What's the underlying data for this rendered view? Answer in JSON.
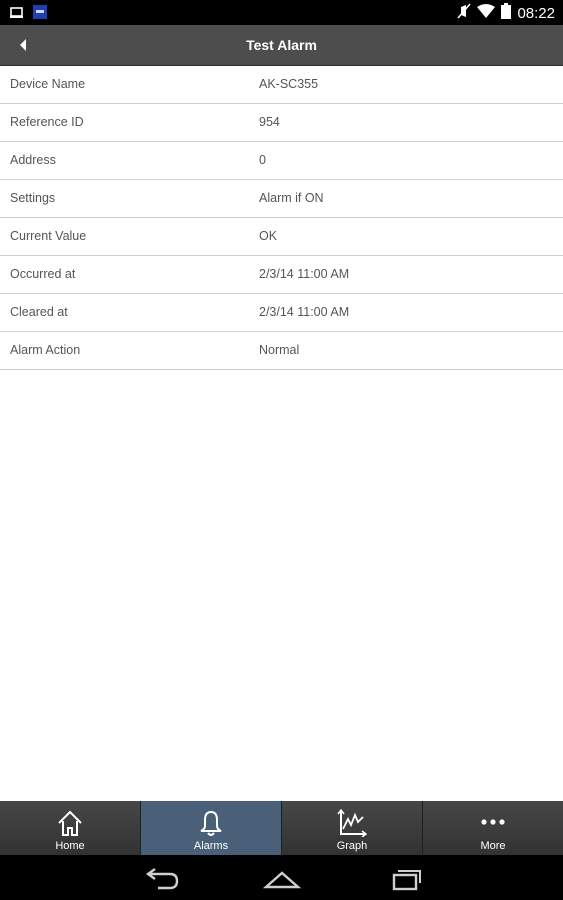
{
  "status_bar": {
    "time": "08:22",
    "icons": [
      "screen-icon",
      "app-notification-icon",
      "mute-icon",
      "wifi-icon",
      "battery-icon"
    ]
  },
  "header": {
    "title": "Test Alarm",
    "back_icon": "back-arrow-icon"
  },
  "details": [
    {
      "label": "Device Name",
      "value": "AK-SC355"
    },
    {
      "label": "Reference ID",
      "value": "954"
    },
    {
      "label": "Address",
      "value": "0"
    },
    {
      "label": "Settings",
      "value": "Alarm if ON"
    },
    {
      "label": "Current Value",
      "value": "OK"
    },
    {
      "label": "Occurred at",
      "value": "2/3/14 11:00 AM"
    },
    {
      "label": "Cleared at",
      "value": "2/3/14 11:00 AM"
    },
    {
      "label": "Alarm Action",
      "value": "Normal"
    }
  ],
  "tabs": [
    {
      "label": "Home",
      "icon": "home-icon",
      "active": false
    },
    {
      "label": "Alarms",
      "icon": "bell-icon",
      "active": true
    },
    {
      "label": "Graph",
      "icon": "graph-icon",
      "active": false
    },
    {
      "label": "More",
      "icon": "more-dots-icon",
      "active": false
    }
  ],
  "nav": {
    "buttons": [
      "back-nav-icon",
      "home-nav-icon",
      "recent-apps-icon"
    ]
  },
  "colors": {
    "header_bg": "#4d4d4d",
    "active_tab_bg": "#4a6079",
    "row_border": "#cfcfcf"
  }
}
